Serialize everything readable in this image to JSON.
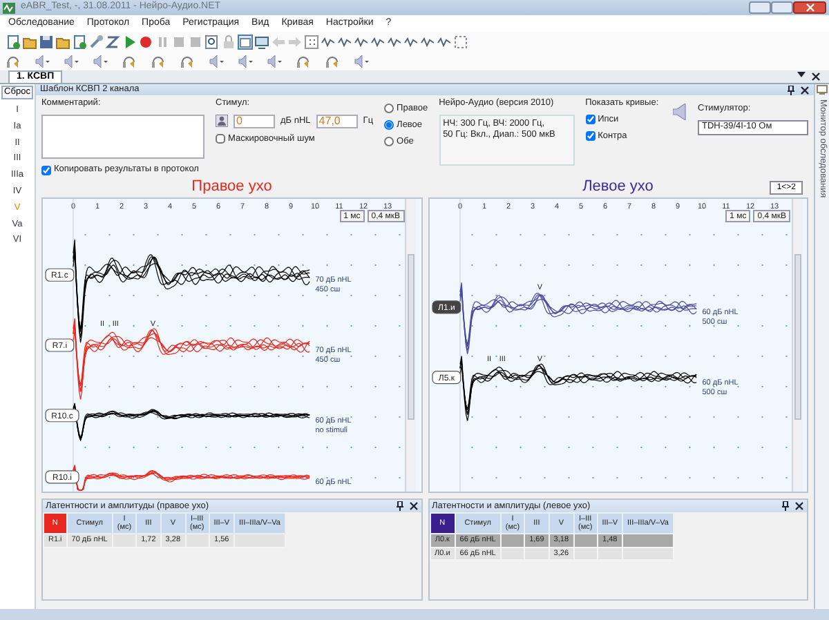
{
  "window": {
    "title": "eABR_Test, -, 31.08.2011 - Нейро-Аудио.NET"
  },
  "menu": [
    "Обследование",
    "Протокол",
    "Проба",
    "Регистрация",
    "Вид",
    "Кривая",
    "Настройки",
    "?"
  ],
  "document_tab": {
    "label": "1. КСВП",
    "selected": true
  },
  "panel_title": "Шаблон КСВП 2 канала",
  "sidebar": {
    "reset": "Сброс",
    "peaks": [
      {
        "label": "I",
        "selected": false
      },
      {
        "label": "Ia",
        "selected": false
      },
      {
        "label": "II",
        "selected": false
      },
      {
        "label": "III",
        "selected": false
      },
      {
        "label": "IIIa",
        "selected": false
      },
      {
        "label": "IV",
        "selected": false
      },
      {
        "label": "V",
        "selected": true
      },
      {
        "label": "Va",
        "selected": false
      },
      {
        "label": "VI",
        "selected": false
      }
    ]
  },
  "comment": {
    "label": "Комментарий:"
  },
  "copy_results": {
    "label": "Копировать результаты в протокол",
    "checked": true
  },
  "stimulus": {
    "label": "Стимул:",
    "level": "0",
    "level_unit": "дБ nHL",
    "rate": "47,0",
    "rate_unit": "Гц"
  },
  "masking": {
    "label": "Маскировочный шум",
    "checked": false
  },
  "ears": [
    {
      "label": "Правое",
      "selected": false
    },
    {
      "label": "Левое",
      "selected": true
    },
    {
      "label": "Обе",
      "selected": false
    }
  ],
  "device": {
    "title": "Нейро-Аудио (версия 2010)",
    "lines": [
      "НЧ: 300 Гц, ВЧ: 2000 Гц,",
      "50 Гц: Вкл., Диап.: 500 мкВ"
    ]
  },
  "show_curves": {
    "label": "Показать кривые:",
    "options": [
      {
        "label": "Ипси",
        "checked": true
      },
      {
        "label": "Контра",
        "checked": true
      }
    ]
  },
  "stimulator": {
    "label": "Стимулятор:",
    "value": "TDH-39/4I-10 Ом"
  },
  "charts": [
    {
      "title": "Правое ухо",
      "color": "#e8281e",
      "timebase": "1 мс",
      "gain": "0,4 мкВ",
      "xticks": [
        "0",
        "1",
        "2",
        "3",
        "4",
        "5",
        "6",
        "7",
        "8",
        "9",
        "10",
        "11",
        "12",
        "13"
      ],
      "traces": [
        {
          "label": "R1.c",
          "selected": false,
          "color": "#000000",
          "note": [
            "70 дБ nHL",
            "450 сш"
          ]
        },
        {
          "label": "R7.i",
          "selected": false,
          "color": "#e8281e",
          "note": [
            "70 дБ nHL",
            "450 сш"
          ],
          "peaks": [
            "II",
            "III",
            "V"
          ]
        },
        {
          "label": "R10.c",
          "selected": false,
          "color": "#000000",
          "note": [
            "60 дБ nHL",
            "no stimuli"
          ]
        },
        {
          "label": "R10.i",
          "selected": false,
          "color": "#e8281e",
          "note": [
            "60 дБ nHL"
          ]
        }
      ]
    },
    {
      "title": "Левое ухо",
      "color": "#3a2a9a",
      "timebase": "1 мс",
      "gain": "0,4 мкВ",
      "swap": "1<>2",
      "xticks": [
        "0",
        "1",
        "2",
        "3",
        "4",
        "5",
        "6",
        "7",
        "8",
        "9",
        "10",
        "11",
        "12",
        "13"
      ],
      "traces": [
        {
          "label": "Л1.и",
          "selected": true,
          "color": "#4a4a9c",
          "note": [
            "60 дБ nHL",
            "500 сш"
          ],
          "peaks": [
            "V"
          ]
        },
        {
          "label": "Л5.к",
          "selected": false,
          "color": "#000000",
          "note": [
            "60 дБ nHL",
            "500 сш"
          ],
          "peaks": [
            "II",
            "III",
            "V"
          ]
        }
      ]
    }
  ],
  "tables": [
    {
      "title": "Латентности и амплитуды (правое ухо)",
      "color": "#e8281e",
      "columns": [
        "N",
        "Стимул",
        "I\n(мс)",
        "III",
        "V",
        "I–III\n(мс)",
        "III–V",
        "III–IIIa/V–Va"
      ],
      "rows": [
        {
          "selected": false,
          "cells": [
            "R1.i",
            "70 дБ nHL",
            null,
            "1,72",
            "3,28",
            null,
            "1,56",
            null
          ]
        }
      ]
    },
    {
      "title": "Латентности и амплитуды (левое ухо)",
      "color": "#3a1f8c",
      "columns": [
        "N",
        "Стимул",
        "I\n(мс)",
        "III",
        "V",
        "I–III\n(мс)",
        "III–V",
        "III–IIIa/V–Va"
      ],
      "rows": [
        {
          "selected": true,
          "cells": [
            "Л0.к",
            "66 дБ nHL",
            null,
            "1,69",
            "3,18",
            null,
            "1,48",
            null
          ]
        },
        {
          "selected": false,
          "cells": [
            "Л0.и",
            "66 дБ nHL",
            null,
            null,
            "3,26",
            null,
            null,
            null
          ]
        }
      ]
    }
  ],
  "side_panel": {
    "title": "Монитор обследования"
  }
}
